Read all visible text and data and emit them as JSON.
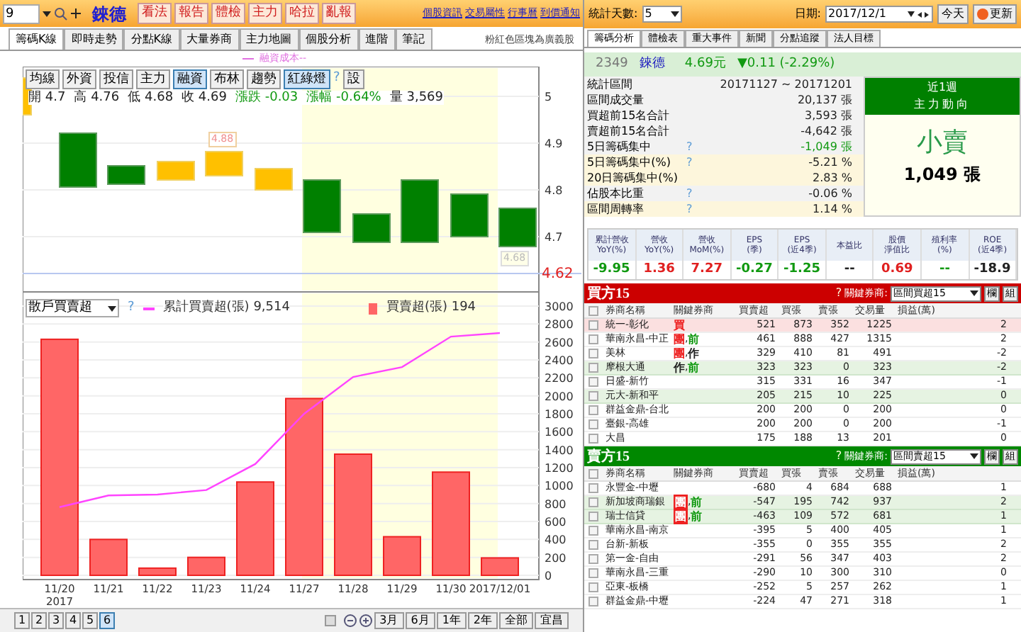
{
  "toolbar": {
    "stock_code": "9",
    "stock_name": "錸德",
    "buttons": [
      "看法",
      "報告",
      "體檢",
      "主力",
      "哈拉",
      "亂報"
    ],
    "links": [
      "個股資訊",
      "交易屬性",
      "行事曆",
      "到價通知"
    ]
  },
  "left_tabs": [
    {
      "label": "籌碼K線",
      "selected": true
    },
    {
      "label": "即時走勢",
      "selected": false
    },
    {
      "label": "分點K線",
      "selected": false
    },
    {
      "label": "大量券商",
      "selected": false
    },
    {
      "label": "主力地圖",
      "selected": false
    },
    {
      "label": "個股分析",
      "selected": false
    },
    {
      "label": "進階",
      "selected": false
    },
    {
      "label": "筆記",
      "selected": false
    }
  ],
  "note": "粉紅色區塊為廣義股",
  "price_chart": {
    "legend": "融資成本--",
    "indicators": [
      {
        "label": "均線",
        "selected": false
      },
      {
        "label": "外資",
        "selected": false
      },
      {
        "label": "投信",
        "selected": false
      },
      {
        "label": "主力",
        "selected": false
      },
      {
        "label": "融資",
        "selected": true
      },
      {
        "label": "布林",
        "selected": false
      },
      {
        "label": "趨勢",
        "selected": false
      },
      {
        "label": "紅綠燈",
        "selected": true
      }
    ],
    "help": "?",
    "settings": "設",
    "ohlc": [
      {
        "label": "開",
        "value": "4.7",
        "color": "#222222"
      },
      {
        "label": "高",
        "value": "4.76",
        "color": "#222222"
      },
      {
        "label": "低",
        "value": "4.68",
        "color": "#222222"
      },
      {
        "label": "收",
        "value": "4.69",
        "color": "#222222"
      },
      {
        "label": "漲跌",
        "value": "-0.03",
        "color": "#119911"
      },
      {
        "label": "漲幅",
        "value": "-0.64%",
        "color": "#119911"
      },
      {
        "label": "量",
        "value": "3,569",
        "color": "#222222"
      }
    ],
    "price_ticks": [
      "5",
      "4.9",
      "4.8",
      "4.7"
    ],
    "high_label": "4.88",
    "low_label": "4.68",
    "last_price": "4.62"
  },
  "volume_chart": {
    "select": "散戶買賣超",
    "help": "?",
    "cumulative_total": "9,514",
    "daily_total": "194",
    "year_label": "2017",
    "chart_data": {
      "type": "bar",
      "stacked": false,
      "grid": true,
      "legend": "top",
      "categories": [
        "11/20",
        "11/21",
        "11/22",
        "11/23",
        "11/24",
        "11/27",
        "11/28",
        "11/29",
        "11/30",
        "2017/12/01"
      ],
      "series": [
        {
          "name": "買賣超(張)",
          "type": "bar",
          "color": "#ff6666",
          "values": [
            2630,
            400,
            80,
            200,
            1040,
            1970,
            1350,
            430,
            1150,
            194
          ]
        },
        {
          "name": "累計買賣超(張)",
          "type": "line",
          "color": "#ff44ff",
          "values": [
            760,
            890,
            900,
            950,
            1240,
            1800,
            2210,
            2320,
            2660,
            2700
          ]
        }
      ],
      "ylim": [
        0,
        3000
      ],
      "yticks": [
        0,
        200,
        400,
        600,
        800,
        1000,
        1200,
        1400,
        1600,
        1800,
        2000,
        2200,
        2400,
        2600,
        2800,
        3000
      ]
    }
  },
  "bottom_bar": {
    "pages": [
      {
        "label": "1",
        "selected": false
      },
      {
        "label": "2",
        "selected": false
      },
      {
        "label": "3",
        "selected": false
      },
      {
        "label": "4",
        "selected": false
      },
      {
        "label": "5",
        "selected": false
      },
      {
        "label": "6",
        "selected": true
      }
    ],
    "ranges": [
      "3月",
      "6月",
      "1年",
      "2年",
      "全部",
      "宜昌"
    ]
  },
  "right_toolbar": {
    "days_label": "統計天數:",
    "days": "5",
    "date_label": "日期:",
    "date": "2017/12/1",
    "today": "今天",
    "refresh": "更新"
  },
  "right_tabs": [
    {
      "label": "籌碼分析",
      "selected": true
    },
    {
      "label": "體檢表",
      "selected": false
    },
    {
      "label": "重大事件",
      "selected": false
    },
    {
      "label": "新聞",
      "selected": false
    },
    {
      "label": "分點追蹤",
      "selected": false
    },
    {
      "label": "法人目標",
      "selected": false
    }
  ],
  "quote": {
    "code": "2349",
    "name": "錸德",
    "price": "4.69元",
    "change": "▼0.11 (-2.29%)"
  },
  "stats": [
    {
      "label": "統計區間",
      "value": "20171127 ~ 20171201",
      "highlighted": false,
      "color": "#222222"
    },
    {
      "label": "區間成交量",
      "value": "20,137 張",
      "highlighted": false,
      "color": "#222222"
    },
    {
      "label": "買超前15名合計",
      "value": "3,593 張",
      "highlighted": false,
      "color": "#222222"
    },
    {
      "label": "賣超前15名合計",
      "value": "-4,642 張",
      "highlighted": false,
      "color": "#222222"
    },
    {
      "label": "5日籌碼集中",
      "help": "?",
      "value": "-1,049 張",
      "highlighted": false,
      "color": "#119911"
    },
    {
      "label": "5日籌碼集中(%)",
      "help": "?",
      "value": "-5.21 %",
      "highlighted": true,
      "color": "#222222"
    },
    {
      "label": "20日籌碼集中(%)",
      "value": "2.83 %",
      "highlighted": true,
      "color": "#222222"
    },
    {
      "label": "佔股本比重",
      "help": "?",
      "value": "-0.06 %",
      "highlighted": false,
      "color": "#222222"
    },
    {
      "label": "區間周轉率",
      "help": "?",
      "value": "1.14 %",
      "highlighted": true,
      "color": "#222222"
    }
  ],
  "trend_box": {
    "period": "近1週",
    "title": "主力動向",
    "direction": "小賣",
    "amount": "1,049 張"
  },
  "financials": [
    {
      "label": "累計營收",
      "sublabel": "YoY(%)",
      "value": "-9.95",
      "color": "#119911"
    },
    {
      "label": "營收",
      "sublabel": "YoY(%)",
      "value": "1.36",
      "color": "#e02020"
    },
    {
      "label": "營收",
      "sublabel": "MoM(%)",
      "value": "7.27",
      "color": "#e02020"
    },
    {
      "label": "EPS",
      "sublabel": "(季)",
      "value": "-0.27",
      "color": "#119911"
    },
    {
      "label": "EPS",
      "sublabel": "(近4季)",
      "value": "-1.25",
      "color": "#119911"
    },
    {
      "label": "本益比",
      "value": "--",
      "color": "#222222"
    },
    {
      "label": "股價",
      "sublabel": "淨值比",
      "value": "0.69",
      "color": "#e02020"
    },
    {
      "label": "殖利率",
      "sublabel": "(%)",
      "value": "--",
      "color": "#119911"
    },
    {
      "label": "ROE",
      "sublabel": "(近4季)",
      "value": "-18.9",
      "color": "#222222"
    }
  ],
  "buy_table": {
    "kind": "buy",
    "title": "買方15",
    "help": "?",
    "key_label": "關鍵券商:",
    "filter": "區間買超15",
    "buttons": [
      "欄",
      "組"
    ],
    "all_checked": false,
    "tag_separator": ",",
    "columns": [
      "券商名稱",
      "關鍵券商",
      "買賣超",
      "買張",
      "賣張",
      "交易量",
      "損益(萬)"
    ],
    "rows": [
      {
        "checked": false,
        "broker": "統一-彰化",
        "tags": [
          {
            "text": "買",
            "color": "#ee2222",
            "boxed": false
          }
        ],
        "net": "521",
        "buy": "873",
        "sell": "352",
        "volume": "1225",
        "pnl": "2",
        "selected": true,
        "highlighted": false
      },
      {
        "checked": false,
        "broker": "華南永昌-中正",
        "tags": [
          {
            "text": "團",
            "color": "#ee2222",
            "boxed": false
          },
          {
            "text": "前",
            "color": "#119911",
            "boxed": false
          }
        ],
        "net": "461",
        "buy": "888",
        "sell": "427",
        "volume": "1315",
        "pnl": "2",
        "selected": false,
        "highlighted": false
      },
      {
        "checked": false,
        "broker": "美林",
        "tags": [
          {
            "text": "團",
            "color": "#ee2222",
            "boxed": false
          },
          {
            "text": "作",
            "color": "#222222",
            "boxed": false
          }
        ],
        "net": "329",
        "buy": "410",
        "sell": "81",
        "volume": "491",
        "pnl": "-2",
        "selected": false,
        "highlighted": false
      },
      {
        "checked": false,
        "broker": "摩根大通",
        "tags": [
          {
            "text": "作",
            "color": "#222222",
            "boxed": false
          },
          {
            "text": "前",
            "color": "#119911",
            "boxed": false
          }
        ],
        "net": "323",
        "buy": "323",
        "sell": "0",
        "volume": "323",
        "pnl": "-2",
        "selected": false,
        "highlighted": true
      },
      {
        "checked": false,
        "broker": "日盛-新竹",
        "tags": [],
        "net": "315",
        "buy": "331",
        "sell": "16",
        "volume": "347",
        "pnl": "-1",
        "selected": false,
        "highlighted": false
      },
      {
        "checked": false,
        "broker": "元大-新和平",
        "tags": [],
        "net": "205",
        "buy": "215",
        "sell": "10",
        "volume": "225",
        "pnl": "0",
        "selected": false,
        "highlighted": true
      },
      {
        "checked": false,
        "broker": "群益金鼎-台北",
        "tags": [],
        "net": "200",
        "buy": "200",
        "sell": "0",
        "volume": "200",
        "pnl": "0",
        "selected": false,
        "highlighted": false
      },
      {
        "checked": false,
        "broker": "臺銀-高雄",
        "tags": [],
        "net": "200",
        "buy": "200",
        "sell": "0",
        "volume": "200",
        "pnl": "-1",
        "selected": false,
        "highlighted": false
      },
      {
        "checked": false,
        "broker": "大昌",
        "tags": [],
        "net": "175",
        "buy": "188",
        "sell": "13",
        "volume": "201",
        "pnl": "0",
        "selected": false,
        "highlighted": false
      }
    ]
  },
  "sell_table": {
    "kind": "sell",
    "title": "賣方15",
    "help": "?",
    "key_label": "關鍵券商:",
    "filter": "區間賣超15",
    "buttons": [
      "欄",
      "組"
    ],
    "all_checked": false,
    "tag_separator": ",",
    "columns": [
      "券商名稱",
      "關鍵券商",
      "買賣超",
      "買張",
      "賣張",
      "交易量",
      "損益(萬)"
    ],
    "rows": [
      {
        "checked": false,
        "broker": "永豐金-中壢",
        "tags": [],
        "net": "-680",
        "buy": "4",
        "sell": "684",
        "volume": "688",
        "pnl": "1",
        "selected": false,
        "highlighted": false
      },
      {
        "checked": false,
        "broker": "新加坡商瑞銀",
        "tags": [
          {
            "text": "團",
            "color": "#ee2222",
            "boxed": true
          },
          {
            "text": "前",
            "color": "#119911",
            "boxed": false
          }
        ],
        "net": "-547",
        "buy": "195",
        "sell": "742",
        "volume": "937",
        "pnl": "2",
        "selected": false,
        "highlighted": true
      },
      {
        "checked": false,
        "broker": "瑞士信貸",
        "tags": [
          {
            "text": "團",
            "color": "#ee2222",
            "boxed": true
          },
          {
            "text": "前",
            "color": "#119911",
            "boxed": false
          }
        ],
        "net": "-463",
        "buy": "109",
        "sell": "572",
        "volume": "681",
        "pnl": "1",
        "selected": false,
        "highlighted": true
      },
      {
        "checked": false,
        "broker": "華南永昌-南京",
        "tags": [],
        "net": "-395",
        "buy": "5",
        "sell": "400",
        "volume": "405",
        "pnl": "1",
        "selected": false,
        "highlighted": false
      },
      {
        "checked": false,
        "broker": "台新-新板",
        "tags": [],
        "net": "-355",
        "buy": "0",
        "sell": "355",
        "volume": "355",
        "pnl": "2",
        "selected": false,
        "highlighted": false
      },
      {
        "checked": false,
        "broker": "第一金-自由",
        "tags": [],
        "net": "-291",
        "buy": "56",
        "sell": "347",
        "volume": "403",
        "pnl": "2",
        "selected": false,
        "highlighted": false
      },
      {
        "checked": false,
        "broker": "華南永昌-三重",
        "tags": [],
        "net": "-290",
        "buy": "10",
        "sell": "300",
        "volume": "310",
        "pnl": "0",
        "selected": false,
        "highlighted": false
      },
      {
        "checked": false,
        "broker": "亞東-板橋",
        "tags": [],
        "net": "-252",
        "buy": "5",
        "sell": "257",
        "volume": "262",
        "pnl": "1",
        "selected": false,
        "highlighted": false
      },
      {
        "checked": false,
        "broker": "群益金鼎-中壢",
        "tags": [],
        "net": "-224",
        "buy": "47",
        "sell": "271",
        "volume": "318",
        "pnl": "1",
        "selected": false,
        "highlighted": false
      }
    ]
  }
}
